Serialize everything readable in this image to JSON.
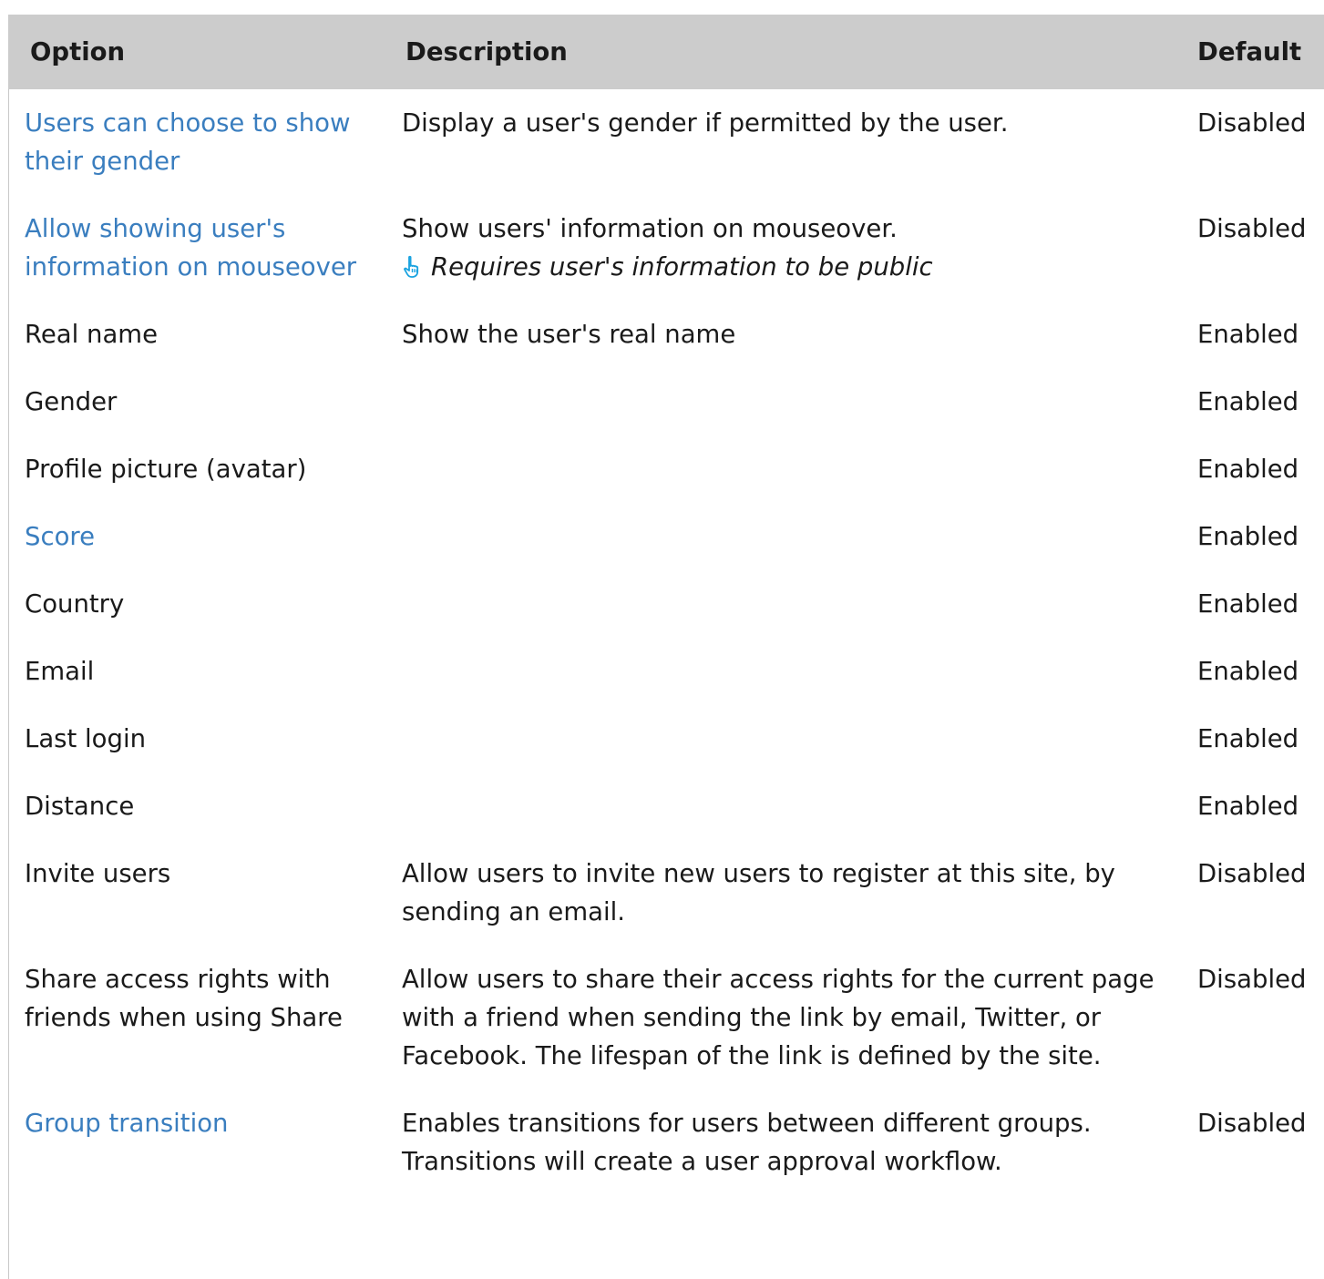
{
  "headers": {
    "option": "Option",
    "description": "Description",
    "default": "Default"
  },
  "rows": [
    {
      "option": "Users can choose to show their gender",
      "is_link": true,
      "description": "Display a user's gender if permitted by the user.",
      "note": "",
      "default": "Disabled"
    },
    {
      "option": "Allow showing user's information on mouseover",
      "is_link": true,
      "description": "Show users' information on mouseover.",
      "note": "Requires user's information to be public",
      "note_icon": "pointing-hand-icon",
      "default": "Disabled"
    },
    {
      "option": "Real name",
      "is_link": false,
      "description": "Show the user's real name",
      "note": "",
      "default": "Enabled"
    },
    {
      "option": "Gender",
      "is_link": false,
      "description": "",
      "note": "",
      "default": "Enabled"
    },
    {
      "option": "Profile picture (avatar)",
      "is_link": false,
      "description": "",
      "note": "",
      "default": "Enabled"
    },
    {
      "option": "Score",
      "is_link": true,
      "description": "",
      "note": "",
      "default": "Enabled"
    },
    {
      "option": "Country",
      "is_link": false,
      "description": "",
      "note": "",
      "default": "Enabled"
    },
    {
      "option": "Email",
      "is_link": false,
      "description": "",
      "note": "",
      "default": "Enabled"
    },
    {
      "option": "Last login",
      "is_link": false,
      "description": "",
      "note": "",
      "default": "Enabled"
    },
    {
      "option": "Distance",
      "is_link": false,
      "description": "",
      "note": "",
      "default": "Enabled"
    },
    {
      "option": "Invite users",
      "is_link": false,
      "description": "Allow users to invite new users to register at this site, by sending an email.",
      "note": "",
      "default": "Disabled"
    },
    {
      "option": "Share access rights with friends when using Share",
      "is_link": false,
      "description": "Allow users to share their access rights for the current page with a friend when sending the link by email, Twitter, or Facebook. The lifespan of the link is defined by the site.",
      "note": "",
      "default": "Disabled"
    },
    {
      "option": "Group transition",
      "is_link": true,
      "description": "Enables transitions for users between different groups. Transitions will create a user approval workflow.",
      "note": "",
      "default": "Disabled"
    }
  ],
  "colors": {
    "header_bg": "#cccccc",
    "link": "#3a7ebf",
    "icon": "#1aa3e0"
  }
}
